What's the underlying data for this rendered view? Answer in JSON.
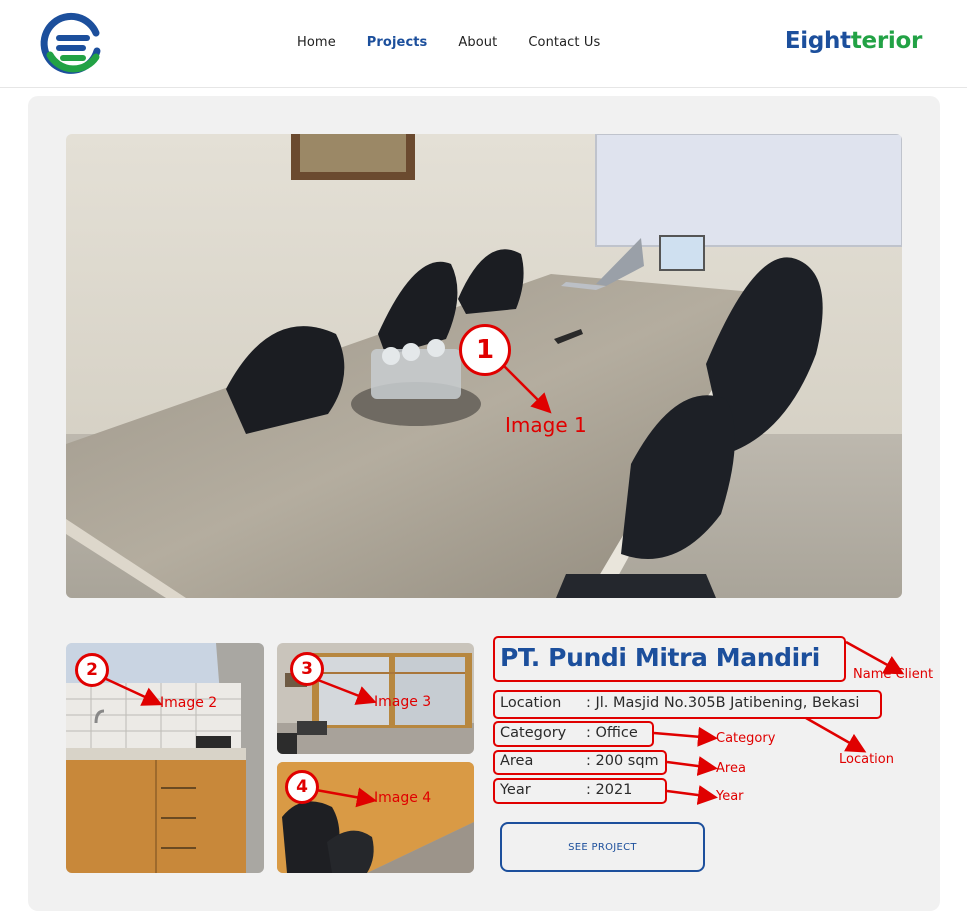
{
  "header": {
    "nav": [
      {
        "label": "Home",
        "active": false
      },
      {
        "label": "Projects",
        "active": true
      },
      {
        "label": "About",
        "active": false
      },
      {
        "label": "Contact Us",
        "active": false
      }
    ],
    "brand_part1": "Eight",
    "brand_part2": "terior"
  },
  "project": {
    "client_name": "PT. Pundi Mitra Mandiri",
    "location_label": "Location",
    "location_value": ": Jl. Masjid No.305B Jatibening, Bekasi",
    "category_label": "Category",
    "category_value": ": Office",
    "area_label": "Area",
    "area_value": ": 200 sqm",
    "year_label": "Year",
    "year_value": ": 2021",
    "button_label": "SEE PROJECT"
  },
  "annotations": {
    "n1": "1",
    "n2": "2",
    "n3": "3",
    "n4": "4",
    "image1": "Image 1",
    "image2": "Image 2",
    "image3": "Image 3",
    "image4": "Image 4",
    "name_client": "Name Client",
    "location": "Location",
    "category": "Category",
    "area": "Area",
    "year": "Year"
  },
  "colors": {
    "primary_blue": "#1c4f9c",
    "brand_green": "#22a245",
    "annotation_red": "#e00000",
    "card_bg": "#f1f1f1"
  },
  "icons": {
    "logo": "eighterior-logo-icon"
  }
}
